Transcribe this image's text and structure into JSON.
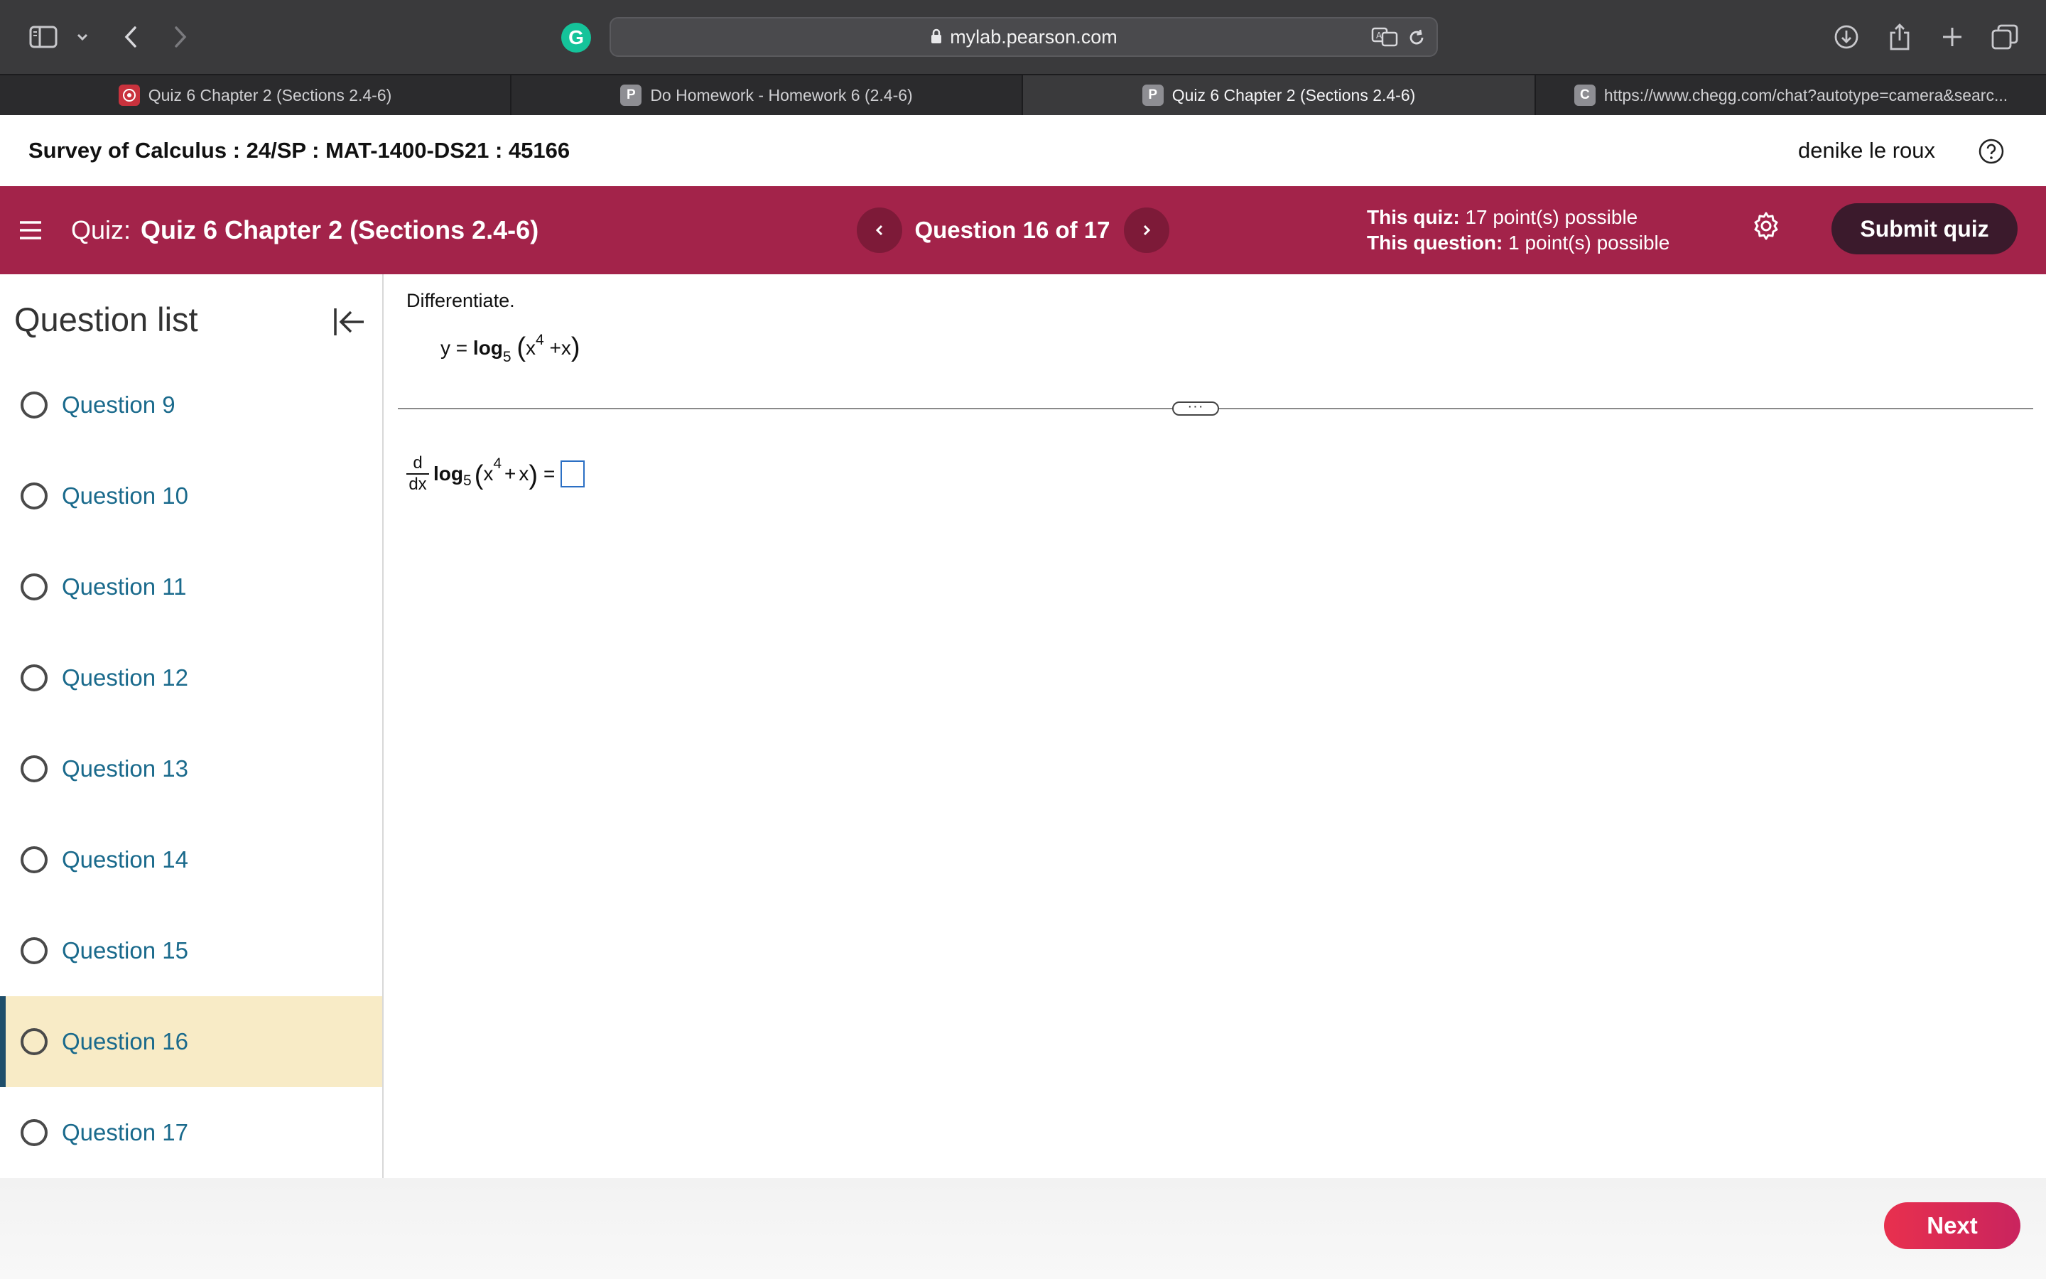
{
  "browser": {
    "address": "mylab.pearson.com",
    "tabs": [
      {
        "label": "Quiz 6 Chapter 2 (Sections 2.4-6)",
        "favicon": "",
        "active": false
      },
      {
        "label": "Do Homework - Homework 6 (2.4-6)",
        "favicon": "P",
        "active": false
      },
      {
        "label": "Quiz 6 Chapter 2 (Sections 2.4-6)",
        "favicon": "P",
        "active": true
      },
      {
        "label": "https://www.chegg.com/chat?autotype=camera&searc...",
        "favicon": "C",
        "active": false
      }
    ],
    "grammarly_letter": "G"
  },
  "course": {
    "title": "Survey of Calculus : 24/SP : MAT-1400-DS21 : 45166",
    "user": "denike le roux"
  },
  "quiz": {
    "prefix": "Quiz:",
    "name": "Quiz 6 Chapter 2 (Sections 2.4-6)",
    "question_indicator": "Question 16 of 17",
    "quiz_points_label": "This quiz:",
    "quiz_points": "17 point(s) possible",
    "question_points_label": "This question:",
    "question_points": "1 point(s) possible",
    "submit_label": "Submit quiz",
    "accent_color": "#a3234a"
  },
  "sidebar": {
    "title": "Question list",
    "items": [
      {
        "label": "Question 9",
        "current": false
      },
      {
        "label": "Question 10",
        "current": false
      },
      {
        "label": "Question 11",
        "current": false
      },
      {
        "label": "Question 12",
        "current": false
      },
      {
        "label": "Question 13",
        "current": false
      },
      {
        "label": "Question 14",
        "current": false
      },
      {
        "label": "Question 15",
        "current": false
      },
      {
        "label": "Question 16",
        "current": true
      },
      {
        "label": "Question 17",
        "current": false
      }
    ]
  },
  "question": {
    "instruction": "Differentiate.",
    "given": {
      "lhs": "y",
      "eq": "=",
      "func": "log",
      "base": "5",
      "inner_var": "x",
      "inner_exp": "4",
      "inner_plus": "+",
      "inner_term": "x"
    },
    "prompt": {
      "d_num": "d",
      "d_den": "dx",
      "func": "log",
      "base": "5",
      "inner_var": "x",
      "inner_exp": "4",
      "inner_plus": "+",
      "inner_term": "x",
      "eq": "="
    },
    "divider_handle": "···"
  },
  "footer": {
    "next_label": "Next"
  }
}
